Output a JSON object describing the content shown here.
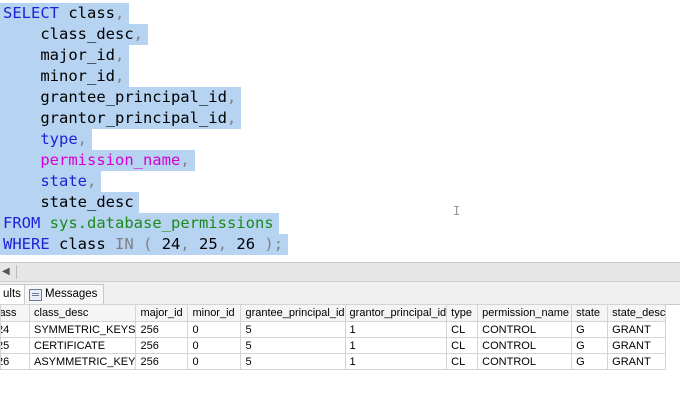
{
  "editor": {
    "lines": [
      {
        "parts": [
          {
            "t": "SELECT",
            "c": "kw"
          },
          {
            "t": " class",
            "c": ""
          },
          {
            "t": ",",
            "c": "gr"
          }
        ]
      },
      {
        "parts": [
          {
            "t": "    class_desc",
            "c": ""
          },
          {
            "t": ",",
            "c": "gr"
          }
        ]
      },
      {
        "parts": [
          {
            "t": "    major_id",
            "c": ""
          },
          {
            "t": ",",
            "c": "gr"
          }
        ]
      },
      {
        "parts": [
          {
            "t": "    minor_id",
            "c": ""
          },
          {
            "t": ",",
            "c": "gr"
          }
        ]
      },
      {
        "parts": [
          {
            "t": "    grantee_principal_id",
            "c": ""
          },
          {
            "t": ",",
            "c": "gr"
          }
        ]
      },
      {
        "parts": [
          {
            "t": "    grantor_principal_id",
            "c": ""
          },
          {
            "t": ",",
            "c": "gr"
          }
        ]
      },
      {
        "parts": [
          {
            "t": "    ",
            "c": ""
          },
          {
            "t": "type",
            "c": "kw"
          },
          {
            "t": ",",
            "c": "gr"
          }
        ]
      },
      {
        "parts": [
          {
            "t": "    ",
            "c": ""
          },
          {
            "t": "permission_name",
            "c": "fn"
          },
          {
            "t": ",",
            "c": "gr"
          }
        ]
      },
      {
        "parts": [
          {
            "t": "    ",
            "c": ""
          },
          {
            "t": "state",
            "c": "kw"
          },
          {
            "t": ",",
            "c": "gr"
          }
        ]
      },
      {
        "parts": [
          {
            "t": "    state_desc",
            "c": ""
          }
        ]
      },
      {
        "parts": [
          {
            "t": "FROM",
            "c": "kw"
          },
          {
            "t": " ",
            "c": ""
          },
          {
            "t": "sys.database_permissions",
            "c": "obj"
          }
        ]
      },
      {
        "parts": [
          {
            "t": "WHERE",
            "c": "kw"
          },
          {
            "t": " class ",
            "c": ""
          },
          {
            "t": "IN",
            "c": "gr"
          },
          {
            "t": " ",
            "c": ""
          },
          {
            "t": "(",
            "c": "gr"
          },
          {
            "t": " 24",
            "c": ""
          },
          {
            "t": ",",
            "c": "gr"
          },
          {
            "t": " 25",
            "c": ""
          },
          {
            "t": ",",
            "c": "gr"
          },
          {
            "t": " 26 ",
            "c": ""
          },
          {
            "t": ");",
            "c": "gr"
          }
        ]
      }
    ],
    "cursor": "I"
  },
  "tabs": {
    "results_label": "ults",
    "messages_label": "Messages"
  },
  "grid": {
    "columns": [
      "lass",
      "class_desc",
      "major_id",
      "minor_id",
      "grantee_principal_id",
      "grantor_principal_id",
      "type",
      "permission_name",
      "state",
      "state_desc"
    ],
    "rows": [
      [
        "24",
        "SYMMETRIC_KEYS",
        "256",
        "0",
        "5",
        "1",
        "CL",
        "CONTROL",
        "G",
        "GRANT"
      ],
      [
        "25",
        "CERTIFICATE",
        "256",
        "0",
        "5",
        "1",
        "CL",
        "CONTROL",
        "G",
        "GRANT"
      ],
      [
        "26",
        "ASYMMETRIC_KEY",
        "256",
        "0",
        "5",
        "1",
        "CL",
        "CONTROL",
        "G",
        "GRANT"
      ]
    ]
  },
  "colors": {
    "selection": "#b7d3f2",
    "keyword": "#1f1fd6",
    "function": "#d400d4",
    "object": "#1b8a1b",
    "operator": "#808080"
  }
}
